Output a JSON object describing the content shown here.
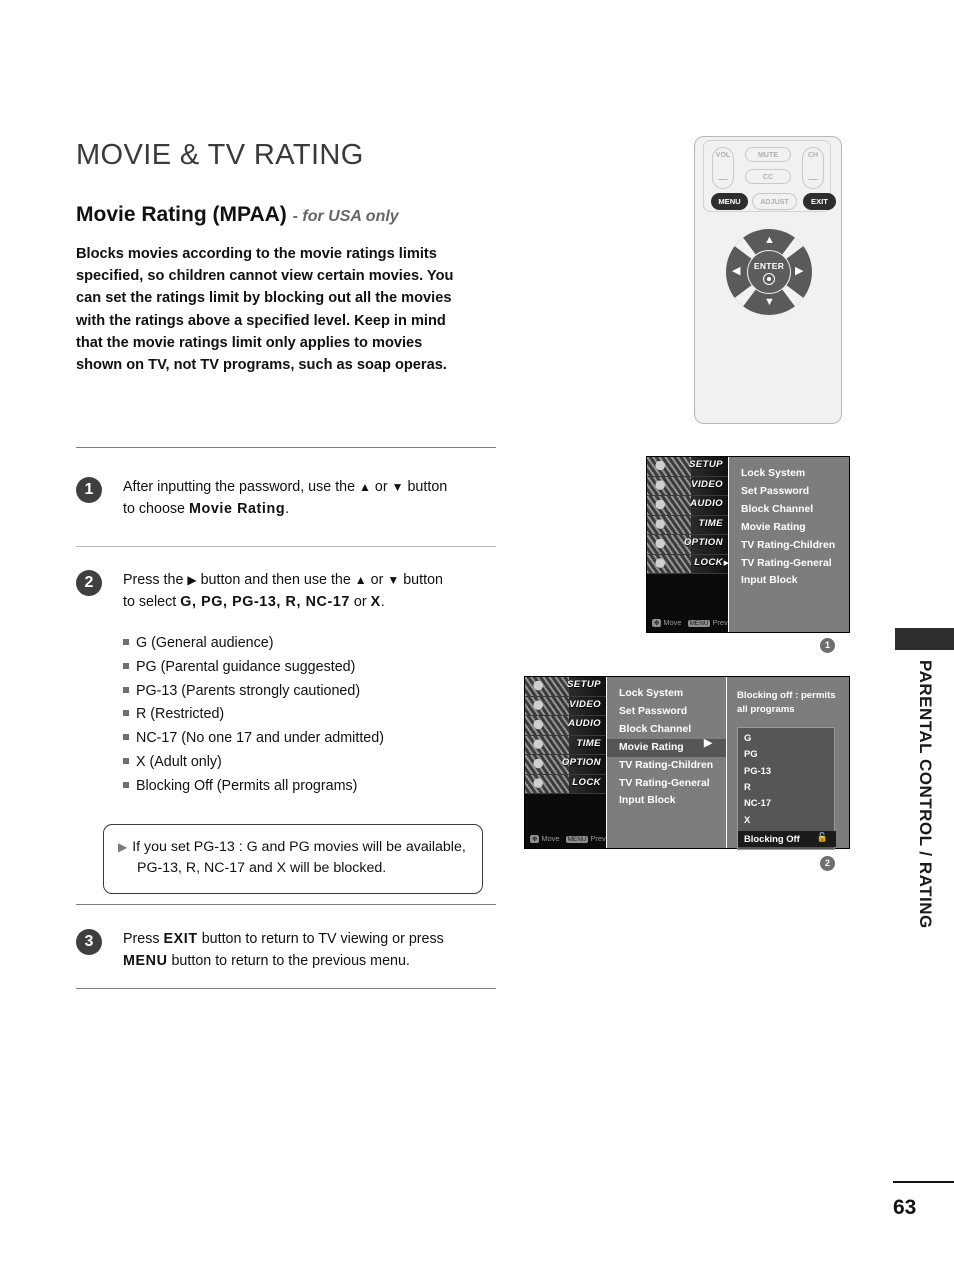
{
  "document": {
    "page_title": "MOVIE & TV RATING",
    "section_heading": "Movie Rating (MPAA)",
    "section_qualifier": "- for USA only",
    "intro_paragraph": "Blocks movies according to the movie ratings limits specified, so children cannot view certain movies. You can set the ratings limit by blocking out all the movies with the ratings above a specified level. Keep in mind that the movie ratings limit only applies to movies shown on TV, not TV programs, such as soap operas.",
    "page_number": "63",
    "side_tab": "PARENTAL CONTROL / RATING"
  },
  "steps": [
    {
      "number": "1",
      "line1_pre": "After inputting the password, use the ",
      "line1_up": "▲",
      "line1_mid": " or ",
      "line1_down": "▼",
      "line1_post": " button",
      "line2_pre": "to choose ",
      "line2_bold": "Movie Rating",
      "line2_post": "."
    },
    {
      "number": "2",
      "line1_pre": "Press the ",
      "line1_right": "▶",
      "line1_mid": " button and then use the  ",
      "line1_up": "▲",
      "line1_mid2": " or ",
      "line1_down": "▼",
      "line1_post": " button",
      "line2_pre": "to select ",
      "line2_opts": "G, PG, PG-13, R, NC-17",
      "line2_post": " or ",
      "line2_last": "X",
      "line2_end": "."
    },
    {
      "number": "3",
      "line1_pre": "Press ",
      "line1_bold": "EXIT",
      "line1_post": " button to return to TV viewing or press",
      "line2_bold": "MENU",
      "line2_post": " button to return to the previous menu."
    }
  ],
  "rating_bullets": [
    "G (General audience)",
    "PG (Parental guidance suggested)",
    "PG-13 (Parents strongly cautioned)",
    "R (Restricted)",
    "NC-17 (No one 17 and under admitted)",
    "X (Adult only)",
    "Blocking Off (Permits all programs)"
  ],
  "note_box": {
    "marker": "▶",
    "line1": "If you set PG-13 : G and PG movies will be available,",
    "line2": "PG-13, R, NC-17 and X will be blocked."
  },
  "remote": {
    "vol_label": "VOL",
    "vol_minus": "—",
    "ch_label": "CH",
    "ch_minus": "—",
    "mute_label": "MUTE",
    "cc_label": "CC",
    "menu_label": "MENU",
    "adjust_label": "ADJUST",
    "exit_label": "EXIT",
    "enter_label": "ENTER",
    "arrow_up": "▲",
    "arrow_down": "▼",
    "arrow_left": "◀",
    "arrow_right": "▶"
  },
  "osd": {
    "categories": [
      "SETUP",
      "VIDEO",
      "AUDIO",
      "TIME",
      "OPTION",
      "LOCK"
    ],
    "footer_move": "Move",
    "footer_prev": "Prev",
    "footer_move_key": "✥",
    "footer_prev_key": "MENU",
    "menu_items": [
      "Lock System",
      "Set Password",
      "Block Channel",
      "Movie Rating",
      "TV Rating-Children",
      "TV Rating-General",
      "Input Block"
    ],
    "figure1_badge": "1",
    "figure2_badge": "2",
    "selected_item": "Movie Rating",
    "selected_arrow": "▶",
    "detail_hint": "Blocking off : permits all programs",
    "rating_options": [
      "G",
      "PG",
      "PG-13",
      "R",
      "NC-17",
      "X"
    ],
    "highlighted_option": "Blocking Off",
    "lock_icon": "🔓"
  },
  "colors": {
    "osd_bg": "#7d7d7d",
    "osd_sidebar": "#0b0b0b",
    "osd_select": "#565656",
    "osd_highlight": "#1b1b1b",
    "badge": "#3f3f3f",
    "tab_block": "#2e2e2e"
  }
}
